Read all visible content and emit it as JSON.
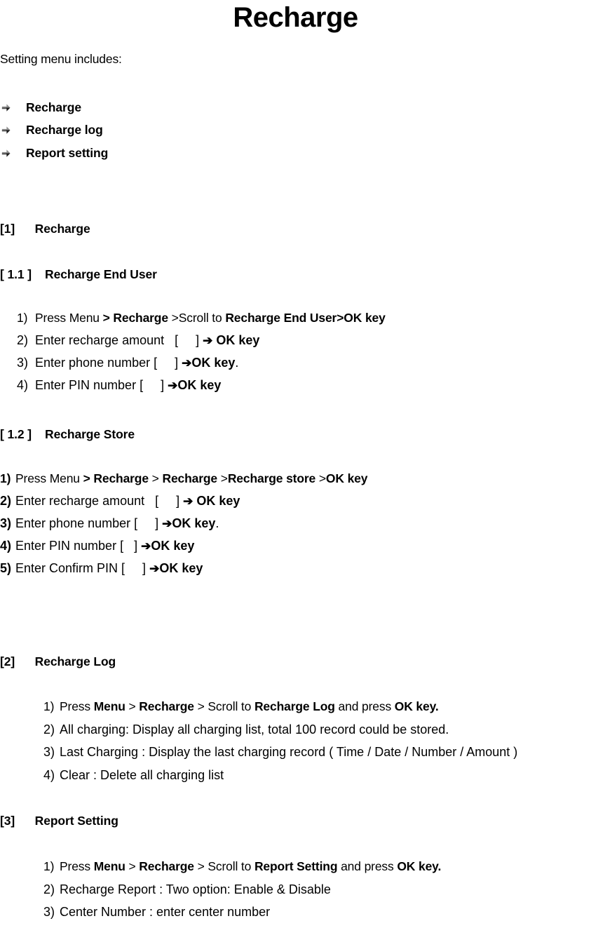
{
  "document": {
    "title": "Recharge",
    "intro": "Setting menu includes:"
  },
  "menu_list": {
    "bullet_icon": "arrow-bullet-icon",
    "items": [
      {
        "label": "Recharge"
      },
      {
        "label": "Recharge log"
      },
      {
        "label": "Report setting"
      }
    ]
  },
  "sections": [
    {
      "number": "[1]",
      "title": "Recharge",
      "heading_text": "[1]      Recharge"
    },
    {
      "number": "[ 1.1 ]",
      "title": "Recharge End User",
      "heading_text": "[ 1.1 ]    Recharge End User",
      "steps": [
        {
          "num": "1)",
          "parts": [
            {
              "t": "Press Menu ",
              "b": false
            },
            {
              "t": "> Recharge ",
              "b": true
            },
            {
              "t": ">Scroll to ",
              "b": false
            },
            {
              "t": "Recharge End User>OK key",
              "b": true
            }
          ]
        },
        {
          "num": "2)",
          "parts": [
            {
              "t": "Enter recharge amount   [     ] ",
              "b": false
            },
            {
              "t": "ARROW",
              "b": true
            },
            {
              "t": " OK key",
              "b": true
            }
          ]
        },
        {
          "num": "3)",
          "parts": [
            {
              "t": "Enter phone number [     ] ",
              "b": false
            },
            {
              "t": "ARROW",
              "b": true
            },
            {
              "t": "OK key",
              "b": true
            },
            {
              "t": ".",
              "b": false
            }
          ]
        },
        {
          "num": "4)",
          "parts": [
            {
              "t": "Enter PIN number [     ] ",
              "b": false
            },
            {
              "t": "ARROW",
              "b": true
            },
            {
              "t": "OK key",
              "b": true
            }
          ]
        }
      ]
    },
    {
      "number": "[ 1.2 ]",
      "title": "Recharge Store",
      "heading_text": "[ 1.2 ]    Recharge Store",
      "steps": [
        {
          "num": "1)",
          "parts": [
            {
              "t": "Press Menu ",
              "b": false
            },
            {
              "t": "> Recharge ",
              "b": true
            },
            {
              "t": "> ",
              "b": false
            },
            {
              "t": "Recharge ",
              "b": true
            },
            {
              "t": ">",
              "b": false
            },
            {
              "t": "Recharge store ",
              "b": true
            },
            {
              "t": ">",
              "b": false
            },
            {
              "t": "OK key",
              "b": true
            }
          ]
        },
        {
          "num": "2)",
          "parts": [
            {
              "t": "Enter recharge amount   [     ] ",
              "b": false
            },
            {
              "t": "ARROW",
              "b": true
            },
            {
              "t": " OK key",
              "b": true
            }
          ]
        },
        {
          "num": "3)",
          "parts": [
            {
              "t": "Enter phone number [     ] ",
              "b": false
            },
            {
              "t": "ARROW",
              "b": true
            },
            {
              "t": "OK key",
              "b": true
            },
            {
              "t": ".",
              "b": false
            }
          ]
        },
        {
          "num": "4)",
          "parts": [
            {
              "t": "Enter PIN number [   ] ",
              "b": false
            },
            {
              "t": "ARROW",
              "b": true
            },
            {
              "t": "OK key",
              "b": true
            }
          ]
        },
        {
          "num": "5)",
          "parts": [
            {
              "t": "Enter Confirm PIN [     ] ",
              "b": false
            },
            {
              "t": "ARROW",
              "b": true
            },
            {
              "t": "OK key",
              "b": true
            }
          ]
        }
      ]
    },
    {
      "number": "[2]",
      "title": "Recharge Log",
      "heading_text": "[2]      Recharge Log",
      "steps": [
        {
          "num": "1)",
          "parts": [
            {
              "t": "Press ",
              "b": false
            },
            {
              "t": "Menu",
              "b": true
            },
            {
              "t": " > ",
              "b": false
            },
            {
              "t": "Recharge",
              "b": true
            },
            {
              "t": " > Scroll to ",
              "b": false
            },
            {
              "t": "Recharge Log",
              "b": true
            },
            {
              "t": " and press ",
              "b": false
            },
            {
              "t": "OK key.",
              "b": true
            }
          ]
        },
        {
          "num": "2)",
          "parts": [
            {
              "t": "All charging: Display all charging list, total 100 record could be stored.",
              "b": false
            }
          ]
        },
        {
          "num": "3)",
          "parts": [
            {
              "t": "Last Charging : Display the last charging record ( Time / Date / Number / Amount )",
              "b": false
            }
          ]
        },
        {
          "num": "4)",
          "parts": [
            {
              "t": "Clear : Delete all charging list",
              "b": false
            }
          ]
        }
      ]
    },
    {
      "number": "[3]",
      "title": "Report Setting",
      "heading_text": "[3]      Report Setting",
      "steps": [
        {
          "num": "1)",
          "parts": [
            {
              "t": "Press ",
              "b": false
            },
            {
              "t": "Menu",
              "b": true
            },
            {
              "t": " > ",
              "b": false
            },
            {
              "t": "Recharge",
              "b": true
            },
            {
              "t": " > Scroll to ",
              "b": false
            },
            {
              "t": "Report Setting",
              "b": true
            },
            {
              "t": " and press ",
              "b": false
            },
            {
              "t": "OK key.",
              "b": true
            }
          ]
        },
        {
          "num": "2)",
          "parts": [
            {
              "t": "Recharge Report : Two option: Enable & Disable",
              "b": false
            }
          ]
        },
        {
          "num": "3)",
          "parts": [
            {
              "t": "Center Number : enter center number",
              "b": false
            }
          ]
        }
      ]
    }
  ],
  "glyphs": {
    "arrow": "➔"
  },
  "colors": {
    "text": "#000000",
    "background": "#ffffff",
    "bullet_dark": "#1a1a1a",
    "bullet_gray": "#8c8c8c"
  }
}
